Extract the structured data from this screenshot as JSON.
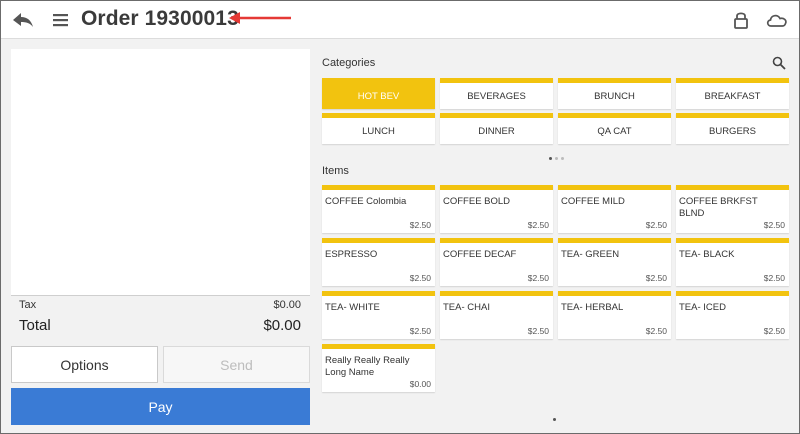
{
  "header": {
    "title": "Order 19300013",
    "back_icon": "back-arrow-icon",
    "menu_icon": "hamburger-menu-icon",
    "lock_icon": "lock-icon",
    "cloud_icon": "cloud-icon",
    "annotation_color": "#e53935"
  },
  "ticket": {
    "tax_label": "Tax",
    "tax_value": "$0.00",
    "total_label": "Total",
    "total_value": "$0.00"
  },
  "actions": {
    "options_label": "Options",
    "send_label": "Send",
    "pay_label": "Pay"
  },
  "categories": {
    "label": "Categories",
    "items": [
      {
        "label": "HOT BEV",
        "active": true
      },
      {
        "label": "BEVERAGES"
      },
      {
        "label": "BRUNCH"
      },
      {
        "label": "BREAKFAST"
      },
      {
        "label": "LUNCH"
      },
      {
        "label": "DINNER"
      },
      {
        "label": "QA CAT"
      },
      {
        "label": "BURGERS"
      }
    ]
  },
  "items": {
    "label": "Items",
    "list": [
      {
        "name": "COFFEE Colombia",
        "price": "$2.50"
      },
      {
        "name": "COFFEE BOLD",
        "price": "$2.50"
      },
      {
        "name": "COFFEE MILD",
        "price": "$2.50"
      },
      {
        "name": "COFFEE BRKFST BLND",
        "price": "$2.50"
      },
      {
        "name": "ESPRESSO",
        "price": "$2.50"
      },
      {
        "name": "COFFEE DECAF",
        "price": "$2.50"
      },
      {
        "name": "TEA- GREEN",
        "price": "$2.50"
      },
      {
        "name": "TEA- BLACK",
        "price": "$2.50"
      },
      {
        "name": "TEA- WHITE",
        "price": "$2.50"
      },
      {
        "name": "TEA- CHAI",
        "price": "$2.50"
      },
      {
        "name": "TEA- HERBAL",
        "price": "$2.50"
      },
      {
        "name": "TEA- ICED",
        "price": "$2.50"
      },
      {
        "name": "Really Really Really Long Name",
        "price": "$0.00"
      }
    ]
  },
  "colors": {
    "accent": "#f2c30f",
    "pay": "#3a7bd5"
  }
}
